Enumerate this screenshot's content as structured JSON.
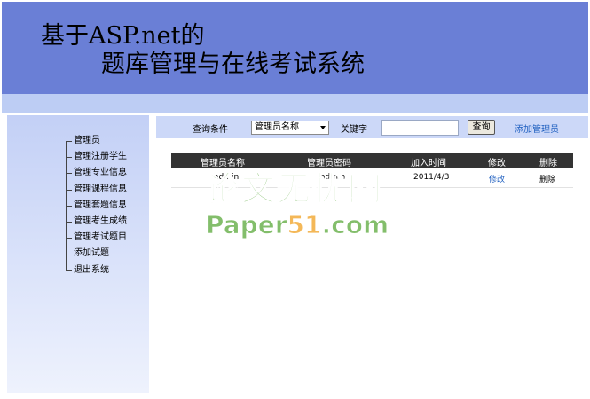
{
  "header": {
    "title_line1": "基于ASP.net的",
    "title_line2": "题库管理与在线考试系统"
  },
  "sidebar": {
    "items": [
      {
        "label": "管理员"
      },
      {
        "label": "管理注册学生"
      },
      {
        "label": "管理专业信息"
      },
      {
        "label": "管理课程信息"
      },
      {
        "label": "管理套题信息"
      },
      {
        "label": "管理考生成绩"
      },
      {
        "label": "管理考试题目"
      },
      {
        "label": "添加试题"
      },
      {
        "label": "退出系统"
      }
    ]
  },
  "search": {
    "condition_label": "查询条件",
    "condition_selected": "管理员名称",
    "keyword_label": "关键字",
    "keyword_value": "",
    "query_button": "查询",
    "add_admin_link": "添加管理员"
  },
  "grid": {
    "columns": [
      "管理员名称",
      "管理员密码",
      "加入时间",
      "修改",
      "删除"
    ],
    "rows": [
      {
        "name": "admin",
        "password": "admin",
        "join_time": "2011/4/3",
        "edit": "修改",
        "delete": "删除"
      }
    ]
  },
  "watermark": {
    "line1": "论文无忧网",
    "line2": "Paper51.com",
    "colors": {
      "green": "#5aa83a",
      "orange": "#f0a020"
    }
  },
  "colors": {
    "header_bg": "#6a7fd6",
    "strip_bg": "#bdcdf4",
    "searchbar_bg": "#ccd8f8",
    "grid_header_bg": "#333333",
    "link": "#2060c0"
  }
}
